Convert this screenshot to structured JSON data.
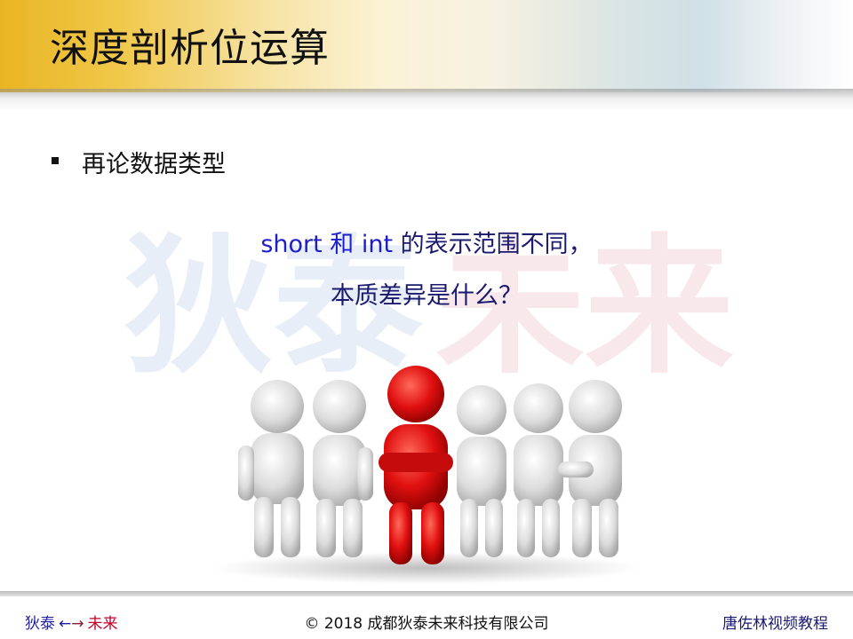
{
  "slide": {
    "title": "深度剖析位运算",
    "bullet": "再论数据类型",
    "question_line1_lead": "short 和 int",
    "question_line1_rest": " 的表示范围不同，",
    "question_line2": "本质差异是什么？",
    "watermark_left": "狄泰",
    "watermark_right": "未来"
  },
  "footer": {
    "left_part1": "狄泰",
    "left_arrow_left": "←",
    "left_arrow_right": "→",
    "left_part2": "未来",
    "center": "© 2018 成都狄泰未来科技有限公司",
    "right": "唐佐林视频教程"
  },
  "colors": {
    "title_gold": "#e9b523",
    "question_text": "#1a1a6e",
    "highlight_figure": "#d51010",
    "footer_red": "#c4002a"
  }
}
